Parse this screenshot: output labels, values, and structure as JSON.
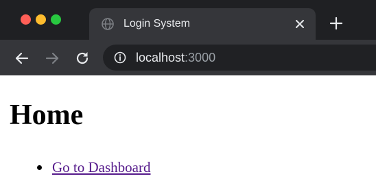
{
  "browser": {
    "tab": {
      "title": "Login System"
    },
    "address_bar": {
      "host": "localhost",
      "port": ":3000"
    }
  },
  "page": {
    "heading": "Home",
    "links": [
      {
        "label": "Go to Dashboard"
      }
    ]
  },
  "colors": {
    "chrome_dark": "#1f2023",
    "chrome_tab": "#35363a",
    "omnibox": "#202124",
    "traffic_red": "#ff5f57",
    "traffic_yellow": "#febc2e",
    "traffic_green": "#28c840",
    "link_visited": "#551a8b"
  },
  "icons": [
    "globe-icon",
    "close-icon",
    "plus-icon",
    "back-arrow-icon",
    "forward-arrow-icon",
    "reload-icon",
    "info-icon"
  ]
}
